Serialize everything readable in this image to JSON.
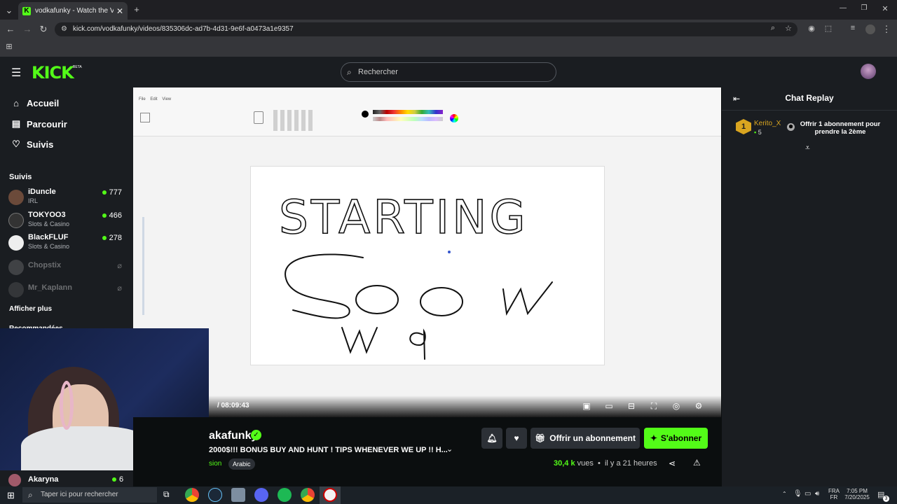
{
  "browser": {
    "tab_title": "vodkafunky - Watch the VOD o",
    "tab_favicon": "K",
    "url": "kick.com/vodkafunky/videos/835306dc-ad7b-4d31-9e6f-a0473a1e9357"
  },
  "header": {
    "logo": "KICK",
    "beta": "BETA",
    "search_placeholder": "Rechercher"
  },
  "sidebar": {
    "nav": [
      {
        "label": "Accueil",
        "icon": "home-icon"
      },
      {
        "label": "Parcourir",
        "icon": "browse-icon"
      },
      {
        "label": "Suivis",
        "icon": "heart-icon"
      }
    ],
    "follows_title": "Suivis",
    "follows": [
      {
        "name": "iDuncle",
        "category": "IRL",
        "viewers": "777"
      },
      {
        "name": "TOKYOO3",
        "category": "Slots & Casino",
        "viewers": "466"
      },
      {
        "name": "BlackFLUF",
        "category": "Slots & Casino",
        "viewers": "278"
      },
      {
        "name": "Chopstix",
        "category": "",
        "viewers": ""
      },
      {
        "name": "Mr_Kaplann",
        "category": "",
        "viewers": ""
      }
    ],
    "show_more": "Afficher plus",
    "recommended_title": "Recommandées",
    "bottom_follow": {
      "name": "Akaryna",
      "viewers": "6"
    }
  },
  "video": {
    "time": "/ 08:09:43",
    "canvas_text": [
      "STARTING",
      "SOON",
      "W9"
    ]
  },
  "info": {
    "channel": "akafunky",
    "title": "2000$!!! BONUS BUY AND HUNT ! TIPS WHENEVER WE UP !! H...",
    "category": "sion",
    "tag": "Arabic",
    "subscribe_gift": "Offrir un abonnement",
    "subscribe": "S'abonner",
    "views": "30,4 k",
    "views_label": "vues",
    "ago": "il y a 21 heures"
  },
  "chat": {
    "title": "Chat Replay",
    "message": {
      "user": "Kerito_X",
      "count": "5",
      "badge": "1",
      "text": "Offrir 1 abonnement pour prendre la 2ème"
    }
  },
  "taskbar": {
    "search": "Taper ici pour rechercher",
    "lang_top": "FRA",
    "lang_bottom": "FR",
    "time": "7:05 PM",
    "date": "7/20/2025",
    "notif": "3"
  },
  "colors": {
    "accent": "#53fc18",
    "bg": "#0b0e0f",
    "panel": "#1a1d21"
  }
}
